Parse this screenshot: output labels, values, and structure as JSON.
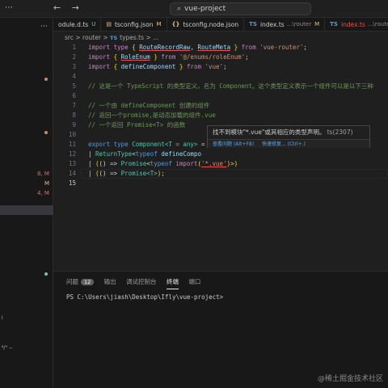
{
  "titlebar": {
    "menu": "⋯",
    "back": "←",
    "forward": "→",
    "search_icon": "search-icon",
    "search_text": "vue-project"
  },
  "sidebar": {
    "more": "⋯",
    "labels": [
      "8, M",
      "M",
      "4, M"
    ],
    "bottom_texts": [
      "i",
      "⁸/\" --",
      "\u0001"
    ]
  },
  "tabs": [
    {
      "icon": "",
      "name": "odule.d.ts",
      "dir": "",
      "mark": "U",
      "color": "#73c991"
    },
    {
      "icon": "tsconfig-icon",
      "glyph": "▤",
      "name": "tsconfig.json",
      "dir": "",
      "mark": "M",
      "color": "#e2c08d"
    },
    {
      "icon": "json-icon",
      "glyph": "{}",
      "name": "tsconfig.node.json",
      "dir": "",
      "mark": "",
      "color": "#cccccc"
    },
    {
      "icon": "ts-icon",
      "glyph": "TS",
      "name": "index.ts",
      "dir": "...\\router",
      "mark": "M",
      "color": "#e2c08d"
    },
    {
      "icon": "ts-icon",
      "glyph": "TS",
      "name": "index.ts",
      "dir": "...\\routes",
      "mark": "",
      "color": "#f14c4c"
    }
  ],
  "breadcrumb": {
    "parts": [
      "src",
      "router",
      "types.ts",
      "..."
    ],
    "sep": ">",
    "ts_badge": "TS"
  },
  "editor": {
    "current_line": 15,
    "lines": [
      {
        "n": "1"
      },
      {
        "n": "2"
      },
      {
        "n": "3"
      },
      {
        "n": "4"
      },
      {
        "n": "5"
      },
      {
        "n": "6"
      },
      {
        "n": "7"
      },
      {
        "n": "8"
      },
      {
        "n": "9"
      },
      {
        "n": "10"
      },
      {
        "n": "11"
      },
      {
        "n": "12"
      },
      {
        "n": "13"
      },
      {
        "n": "14"
      },
      {
        "n": "15"
      }
    ],
    "tokens": {
      "l1_import": "import",
      "l1_type": "type",
      "l1_ob": "{ ",
      "l1_a": "RouteRecordRaw",
      "l1_comma": ", ",
      "l1_b": "RouteMeta",
      "l1_cb": " }",
      "l1_from": " from ",
      "l1_str": "'vue-router'",
      "l1_semi": ";",
      "l2_import": "import",
      "l2_ob": "{ ",
      "l2_a": "RoleEnum",
      "l2_cb": " }",
      "l2_from": " from ",
      "l2_str": "'@/enums/roleEnum'",
      "l2_semi": ";",
      "l3_import": "import",
      "l3_ob": "{ ",
      "l3_a": "defineComponent",
      "l3_cb": " }",
      "l3_from": " from ",
      "l3_str": "'vue'",
      "l3_semi": ";",
      "l5": "// 这是一个 TypeScript 的类型定义，名为 Component。这个类型定义表示一个组件可以是以下三种",
      "l7": "// 一个由 defineComponent 创建的组件",
      "l8": "// 返回一个promise,是动态加载的组件.vue",
      "l9": "// 一个返回 Promise<T> 的函数",
      "l11_export": "export",
      "l11_type": "type",
      "l11_name": "Component",
      "l11_gen": "<T = any>",
      "l11_eq": " =",
      "l12_bar": "| ",
      "l12_rt": "ReturnType",
      "l12_lt": "<",
      "l12_typeof": "typeof",
      "l12_dc": "defineCompo",
      "l13_bar": "| ",
      "l13_p1": "(",
      "l13_arrow": "() => ",
      "l13_prom": "Promise",
      "l13_lt": "<",
      "l13_typeof": "typeof",
      "l13_import": "import",
      "l13_op": "(",
      "l13_str": "'*.vue'",
      "l13_end": ")>)",
      "l14_bar": "| ",
      "l14_p1": "(",
      "l14_arrow": "() => ",
      "l14_prom": "Promise",
      "l14_t": "<T>",
      "l14_end": ");"
    }
  },
  "tooltip": {
    "message": "找不到模块\"*.vue\"或其相应的类型声明。",
    "code": "ts(2307)",
    "view_problem": "查看问题",
    "view_problem_key": "(Alt+F8)",
    "quick_fix": "快速修复...",
    "quick_fix_key": "(Ctrl+.)"
  },
  "panel": {
    "tabs": [
      {
        "label": "问题",
        "badge": "12"
      },
      {
        "label": "输出"
      },
      {
        "label": "调试控制台"
      },
      {
        "label": "终端",
        "active": true
      },
      {
        "label": "端口"
      }
    ],
    "terminal_prompt": "PS C:\\Users\\jiash\\Desktop\\Ifly\\vue-project>"
  },
  "watermark": "@稀土掘金技术社区",
  "colors": {
    "background": "#1f1f1f",
    "keyword": "#c586c0",
    "type": "#4ec9b0",
    "string": "#ce9178",
    "comment": "#6a9955",
    "error": "#f14c4c"
  }
}
